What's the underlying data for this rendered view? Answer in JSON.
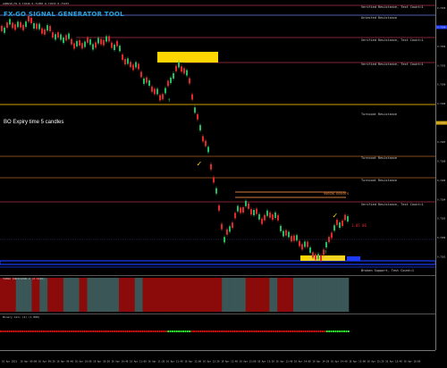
{
  "header": {
    "symbol_info": "AUDUSD,M1 0.71946 0.71950 0.71933 0.71933",
    "app_title": "FX-GO SIGNAL GENERATOR TOOL",
    "expiry_note": "BO Expiry time 5 candles"
  },
  "levels": [
    {
      "id": "top",
      "label": "Verified Resistance, Test Count=1",
      "color": "#b03048"
    },
    {
      "id": "l2",
      "label": "Untested Resistance",
      "color": "#6b7be0"
    },
    {
      "id": "l3",
      "label": "Verified Resistance, Test Count=1",
      "color": "#b03048"
    },
    {
      "id": "l4",
      "label": "Verified Resistance, Test Count=1",
      "color": "#b03048"
    },
    {
      "id": "l5",
      "label": "Turncoat Resistance",
      "color": "#d0a000"
    },
    {
      "id": "l6",
      "label": "Turncoat Resistance",
      "color": "#b06020"
    },
    {
      "id": "l7",
      "label": "Turncoat Resistance",
      "color": "#b06020"
    },
    {
      "id": "l8",
      "label": "Verified Resistance, Test Count=1",
      "color": "#b03048"
    },
    {
      "id": "weak",
      "label": "Weak sellers",
      "color": "#d27a3a"
    },
    {
      "id": "support",
      "label": "Broken Support, Test Count=1",
      "color": "#3050e0"
    }
  ],
  "annotations": {
    "price_tag": "1.05 00",
    "zone_label": "Weak sellers"
  },
  "panes": {
    "osc1_title": "TREND INDICATOR 2 (0.0195)",
    "osc2_title": "Binary Calc (4) (1.000)"
  },
  "price_axis": {
    "labels": [
      "0.7195",
      "0.7194",
      "0.7192",
      "0.7191",
      "0.7190",
      "0.7189",
      "0.7188",
      "0.7187",
      "0.7186",
      "0.7185",
      "0.7184",
      "0.7183",
      "0.7182",
      "0.7181"
    ],
    "highlight_values": [
      "0.7194",
      "0.7188"
    ]
  },
  "time_axis": {
    "labels": [
      "16 Apr 2021",
      "16 Apr 09:00",
      "16 Apr 09:20",
      "16 Apr 09:40",
      "16 Apr 10:00",
      "16 Apr 10:20",
      "16 Apr 10:40",
      "16 Apr 11:00",
      "16 Apr 11:20",
      "16 Apr 11:40",
      "16 Apr 12:00",
      "16 Apr 12:20",
      "16 Apr 12:40",
      "16 Apr 13:00",
      "16 Apr 13:20",
      "16 Apr 13:40",
      "16 Apr 14:00",
      "16 Apr 14:20",
      "16 Apr 14:40",
      "16 Apr 15:00",
      "16 Apr 15:20",
      "16 Apr 15:40",
      "16 Apr 16:00"
    ]
  },
  "colors": {
    "bull": "#20c060",
    "bear": "#e02828",
    "zone_yellow": "#ffd700",
    "support_blue": "#1e3cff",
    "osc_red": "#8b0a0a",
    "osc_gray": "#3a5656"
  }
}
